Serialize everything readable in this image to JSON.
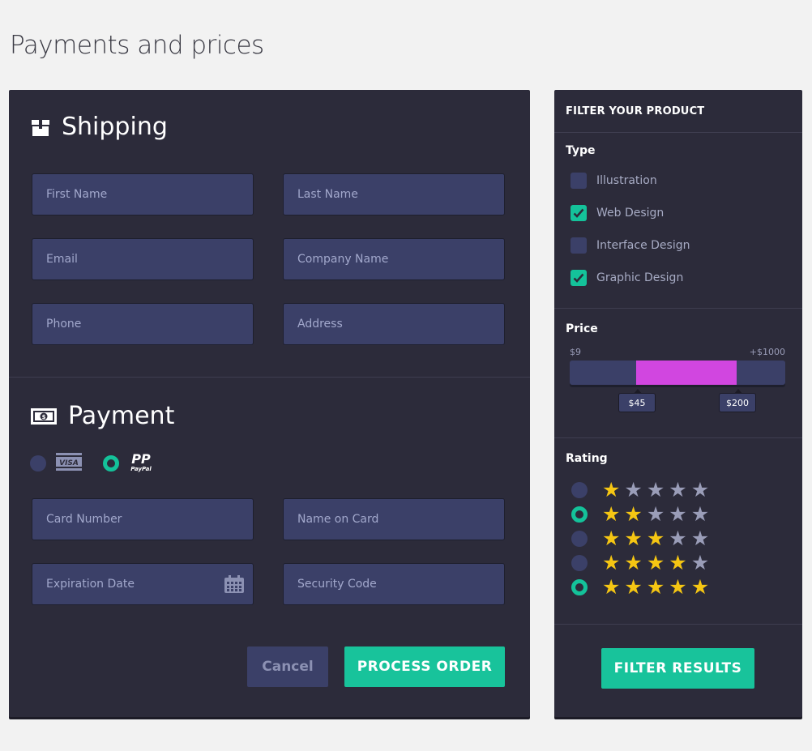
{
  "page": {
    "title": "Payments and prices"
  },
  "shipping": {
    "heading": "Shipping",
    "fields": {
      "first_name": "First Name",
      "last_name": "Last Name",
      "email": "Email",
      "company": "Company Name",
      "phone": "Phone",
      "address": "Address"
    }
  },
  "payment": {
    "heading": "Payment",
    "methods": [
      {
        "name": "VISA",
        "selected": false
      },
      {
        "name": "PayPal",
        "selected": true
      }
    ],
    "fields": {
      "card_number": "Card Number",
      "name_on_card": "Name on Card",
      "expiration": "Expiration Date",
      "security": "Security Code"
    },
    "cancel_label": "Cancel",
    "process_label": "PROCESS ORDER"
  },
  "filter": {
    "title": "FILTER YOUR PRODUCT",
    "type_label": "Type",
    "types": [
      {
        "label": "Illustration",
        "checked": false
      },
      {
        "label": "Web Design",
        "checked": true
      },
      {
        "label": "Interface Design",
        "checked": false
      },
      {
        "label": "Graphic Design",
        "checked": true
      }
    ],
    "price_label": "Price",
    "price_min": "$9",
    "price_max": "+$1000",
    "price_low": "$45",
    "price_high": "$200",
    "rating_label": "Rating",
    "ratings": [
      {
        "stars": 1,
        "selected": false
      },
      {
        "stars": 2,
        "selected": true
      },
      {
        "stars": 3,
        "selected": false
      },
      {
        "stars": 4,
        "selected": false
      },
      {
        "stars": 5,
        "selected": true
      }
    ],
    "filter_label": "FILTER RESULTS"
  },
  "colors": {
    "accent": "#18c39b",
    "range": "#d146e0",
    "star": "#f5c613",
    "field": "#3b4068",
    "panel": "#2c2b3a"
  }
}
